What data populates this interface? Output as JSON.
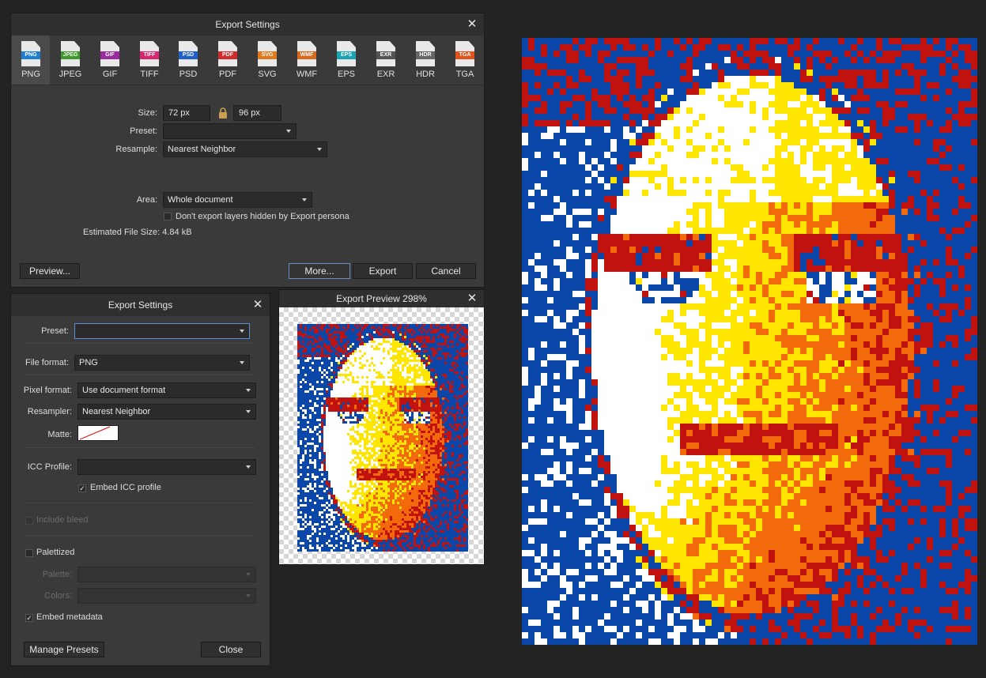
{
  "export_dialog": {
    "title": "Export Settings",
    "formats": [
      {
        "label": "PNG",
        "tag": "PNG",
        "color": "#1e7fd1"
      },
      {
        "label": "JPEG",
        "tag": "JPEG",
        "color": "#3c9a2b"
      },
      {
        "label": "GIF",
        "tag": "GIF",
        "color": "#9a2aa0"
      },
      {
        "label": "TIFF",
        "tag": "TIFF",
        "color": "#d6286f"
      },
      {
        "label": "PSD",
        "tag": "PSD",
        "color": "#1f5fc6"
      },
      {
        "label": "PDF",
        "tag": "PDF",
        "color": "#d22b2b"
      },
      {
        "label": "SVG",
        "tag": "SVG",
        "color": "#e07a1f"
      },
      {
        "label": "WMF",
        "tag": "WMF",
        "color": "#d86a1d"
      },
      {
        "label": "EPS",
        "tag": "EPS",
        "color": "#1aa3b5"
      },
      {
        "label": "EXR",
        "tag": "EXR",
        "color": "#555555"
      },
      {
        "label": "HDR",
        "tag": "HDR",
        "color": "#666666"
      },
      {
        "label": "TGA",
        "tag": "TGA",
        "color": "#e0531b"
      }
    ],
    "selected_format": "PNG",
    "size_label": "Size:",
    "width": "72 px",
    "height": "96 px",
    "preset_label": "Preset:",
    "preset_value": "",
    "resample_label": "Resample:",
    "resample_value": "Nearest Neighbor",
    "area_label": "Area:",
    "area_value": "Whole document",
    "hidden_layers_label": "Don't export layers hidden by Export persona",
    "file_size": "Estimated File Size: 4.84 kB",
    "preview_btn": "Preview...",
    "more_btn": "More...",
    "export_btn": "Export",
    "cancel_btn": "Cancel"
  },
  "more_dialog": {
    "title": "Export Settings",
    "preset_label": "Preset:",
    "preset_value": "",
    "file_format_label": "File format:",
    "file_format_value": "PNG",
    "pixel_format_label": "Pixel format:",
    "pixel_format_value": "Use document format",
    "resampler_label": "Resampler:",
    "resampler_value": "Nearest Neighbor",
    "matte_label": "Matte:",
    "icc_label": "ICC Profile:",
    "icc_value": "",
    "embed_icc_label": "Embed ICC profile",
    "embed_icc_checked": true,
    "bleed_label": "Include bleed",
    "palettized_label": "Palettized",
    "palette_label": "Palette:",
    "colors_label": "Colors:",
    "embed_metadata_label": "Embed metadata",
    "embed_metadata_checked": true,
    "manage_btn": "Manage Presets",
    "close_btn": "Close"
  },
  "preview": {
    "title": "Export Preview 298%"
  },
  "pixel_palette": [
    "#0b47a8",
    "#c0120f",
    "#f26a0b",
    "#ffe600",
    "#ffffff"
  ]
}
